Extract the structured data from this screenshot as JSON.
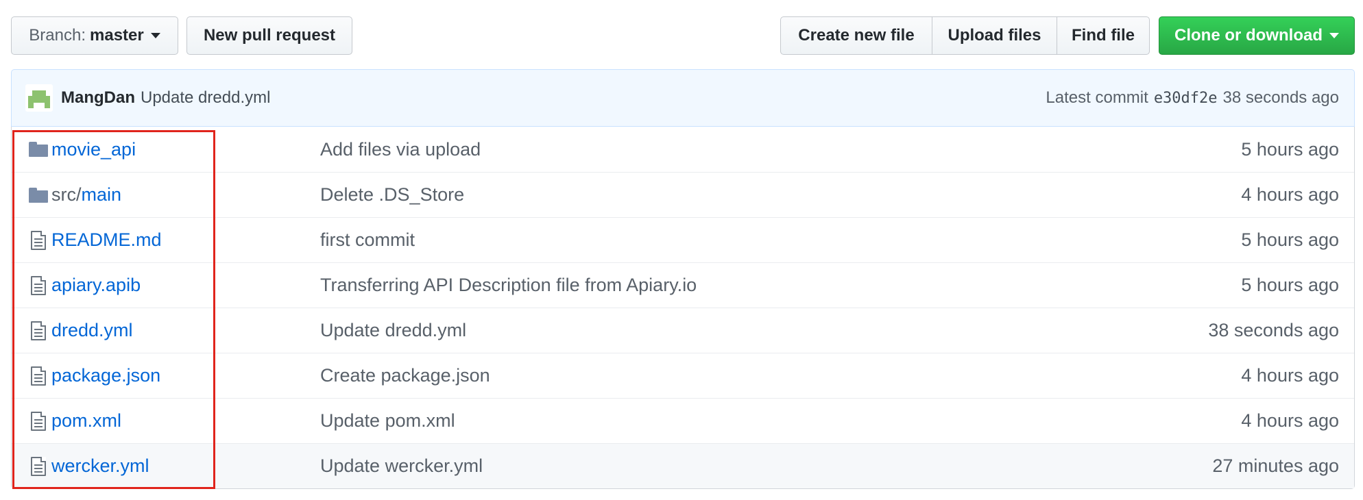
{
  "toolbar": {
    "branch_prefix": "Branch:",
    "branch_name": "master",
    "new_pull_request": "New pull request",
    "create_new_file": "Create new file",
    "upload_files": "Upload files",
    "find_file": "Find file",
    "clone_or_download": "Clone or download"
  },
  "commit": {
    "author": "MangDan",
    "message": "Update dredd.yml",
    "latest_label": "Latest commit",
    "sha": "e30df2e",
    "age": "38 seconds ago"
  },
  "files": [
    {
      "type": "folder",
      "icon": "folder-icon",
      "name": "movie_api",
      "message": "Add files via upload",
      "age": "5 hours ago"
    },
    {
      "type": "folder",
      "icon": "folder-icon",
      "name_dir": "src/",
      "name": "main",
      "message": "Delete .DS_Store",
      "age": "4 hours ago"
    },
    {
      "type": "file",
      "icon": "file-icon",
      "name": "README.md",
      "message": "first commit",
      "age": "5 hours ago"
    },
    {
      "type": "file",
      "icon": "file-icon",
      "name": "apiary.apib",
      "message": "Transferring API Description file from Apiary.io",
      "age": "5 hours ago"
    },
    {
      "type": "file",
      "icon": "file-icon",
      "name": "dredd.yml",
      "message": "Update dredd.yml",
      "age": "38 seconds ago"
    },
    {
      "type": "file",
      "icon": "file-icon",
      "name": "package.json",
      "message": "Create package.json",
      "age": "4 hours ago"
    },
    {
      "type": "file",
      "icon": "file-icon",
      "name": "pom.xml",
      "message": "Update pom.xml",
      "age": "4 hours ago"
    },
    {
      "type": "file",
      "icon": "file-icon",
      "name": "wercker.yml",
      "message": "Update wercker.yml",
      "age": "27 minutes ago"
    }
  ],
  "colors": {
    "link": "#0366d6",
    "clone_button": "#28a745",
    "commit_bar_bg": "#f1f8ff",
    "highlight_border": "#e0241c"
  }
}
